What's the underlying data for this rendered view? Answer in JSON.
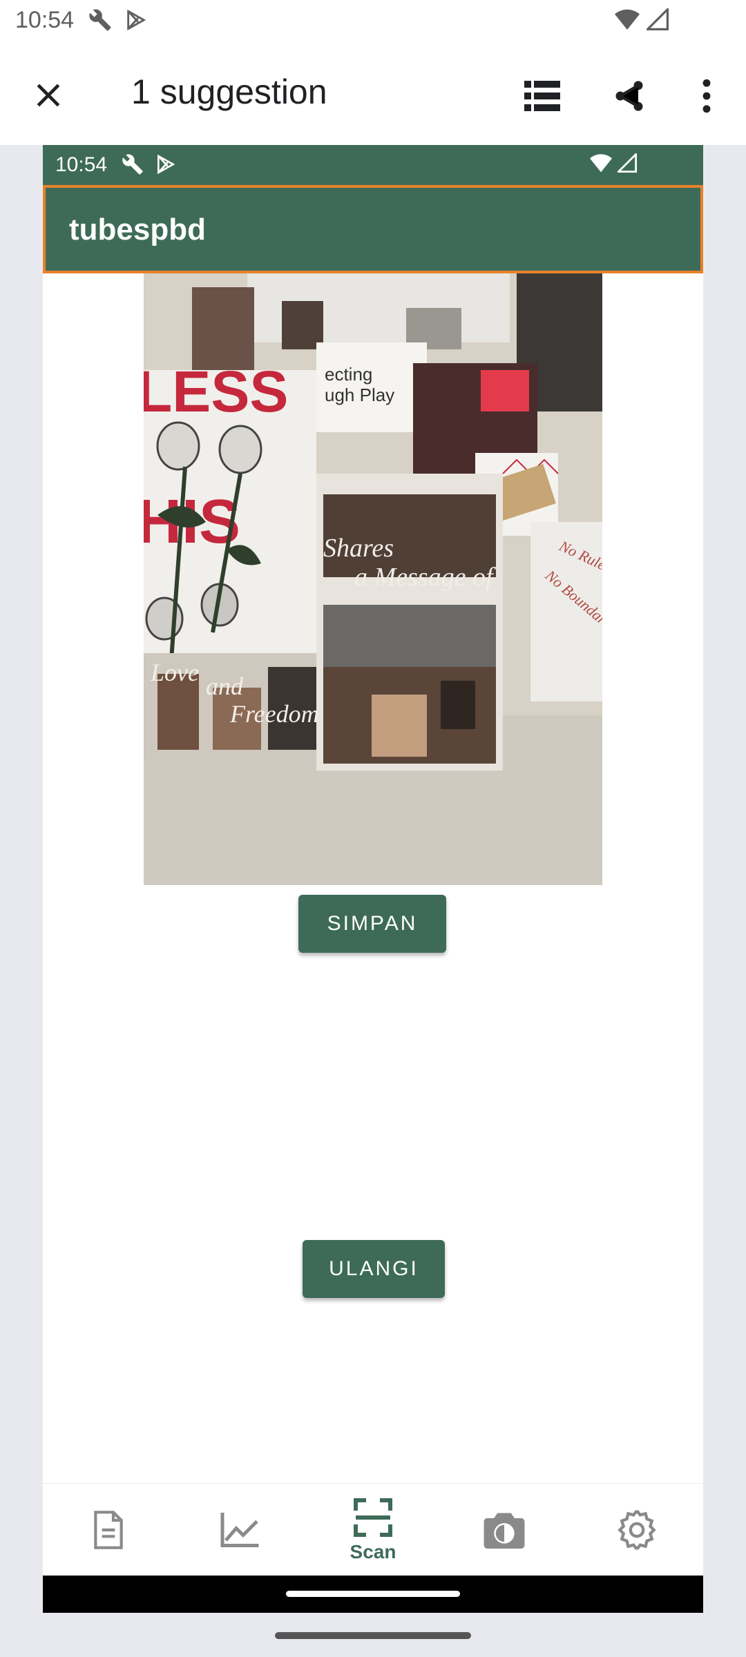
{
  "outer_status": {
    "time": "10:54"
  },
  "toolbar": {
    "title": "1 suggestion"
  },
  "inner_status": {
    "time": "10:54"
  },
  "app_bar": {
    "title": "tubespbd"
  },
  "buttons": {
    "save_label": "SIMPAN",
    "retry_label": "ULANGI"
  },
  "bottom_nav": {
    "items": [
      {
        "icon": "document-icon",
        "label": ""
      },
      {
        "icon": "chart-icon",
        "label": ""
      },
      {
        "icon": "scan-icon",
        "label": "Scan",
        "selected": true
      },
      {
        "icon": "camera-switch-icon",
        "label": ""
      },
      {
        "icon": "settings-icon",
        "label": ""
      }
    ]
  },
  "photo": {
    "description_text": [
      "LESS",
      "HIS",
      "ecting",
      "ugh Play",
      "Shares",
      "a Message of",
      "Love",
      "and",
      "Freedom",
      "No Rule",
      "No Boundari"
    ]
  },
  "colors": {
    "accent": "#3e6b58",
    "highlight_border": "#e8822a"
  }
}
